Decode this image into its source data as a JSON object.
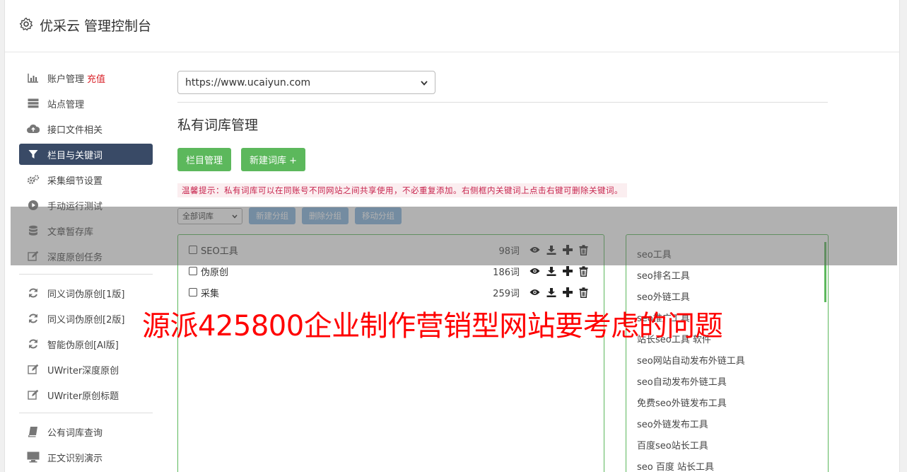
{
  "header": {
    "title": "优采云 管理控制台",
    "icon": "gear-icon"
  },
  "sidebar": {
    "items": [
      {
        "label": "账户管理",
        "badge": "充值",
        "icon": "bar-chart-icon"
      },
      {
        "label": "站点管理",
        "icon": "server-icon"
      },
      {
        "label": "接口文件相关",
        "icon": "cloud-upload-icon"
      },
      {
        "label": "栏目与关键词",
        "icon": "filter-icon",
        "active": true
      },
      {
        "label": "采集细节设置",
        "icon": "cogs-icon"
      },
      {
        "label": "手动运行测试",
        "icon": "play-circle-icon"
      },
      {
        "label": "文章暂存库",
        "icon": "database-icon"
      },
      {
        "label": "深度原创任务",
        "icon": "edit-icon"
      }
    ],
    "items2": [
      {
        "label": "同义词伪原创[1版]",
        "icon": "refresh-icon"
      },
      {
        "label": "同义词伪原创[2版]",
        "icon": "refresh-icon"
      },
      {
        "label": "智能伪原创[AI版]",
        "icon": "refresh-icon"
      },
      {
        "label": "UWriter深度原创",
        "icon": "edit-icon"
      },
      {
        "label": "UWriter原创标题",
        "icon": "edit-icon"
      }
    ],
    "items3": [
      {
        "label": "公有词库查询",
        "icon": "book-icon"
      },
      {
        "label": "正文识别演示",
        "icon": "monitor-icon"
      }
    ]
  },
  "main": {
    "site_select": "https://www.ucaiyun.com",
    "section_title": "私有词库管理",
    "btn_column": "栏目管理",
    "btn_new_lib": "新建词库 +",
    "tip": "温馨提示：私有词库可以在同账号不同网站之间共享使用，不必重复添加。右侧框内关键词上点击右键可删除关键词。",
    "group_select": "全部词库",
    "btn_new_group": "新建分组",
    "btn_del_group": "删除分组",
    "btn_move_group": "移动分组",
    "libraries": [
      {
        "name": "SEO工具",
        "count": "98词"
      },
      {
        "name": "伪原创",
        "count": "186词"
      },
      {
        "name": "采集",
        "count": "259词"
      }
    ],
    "keywords": [
      "seo工具",
      "seo排名工具",
      "seo外链工具",
      "seo推广工具",
      "站长seo工具 软件",
      "seo网站自动发布外链工具",
      "seo自动发布外链工具",
      "免费seo外链发布工具",
      "seo外链发布工具",
      "百度seo站长工具",
      "seo 百度 站长工具"
    ]
  },
  "watermark": "源派425800企业制作营销型网站要考虑的问题",
  "colors": {
    "accent_green": "#5cb85c",
    "active_nav": "#394a66",
    "tip_text": "#c7254e",
    "watermark": "#ff0000"
  }
}
